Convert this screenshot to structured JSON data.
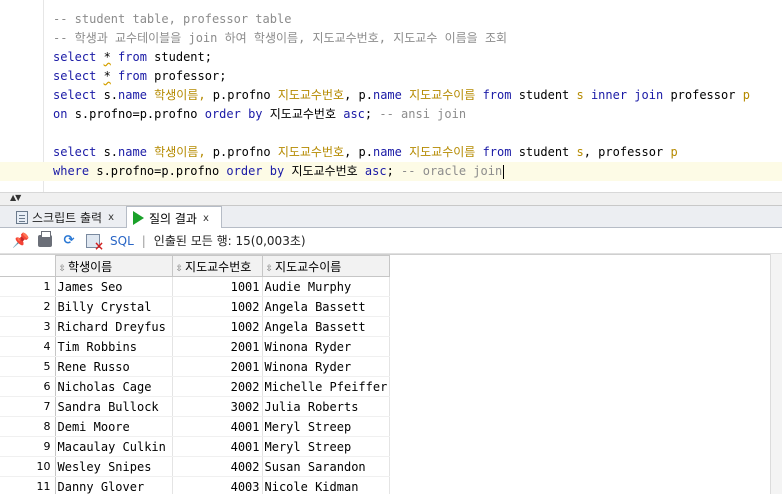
{
  "editor": {
    "lines": [
      [
        {
          "t": "-- student table, professor table",
          "c": "cm"
        }
      ],
      [
        {
          "t": "-- 학생과 교수테이블을 join 하여 학생이름, 지도교수번호, 지도교수 이름을 조회",
          "c": "cm"
        }
      ],
      [
        {
          "t": "select ",
          "c": "kw"
        },
        {
          "t": "*",
          "c": "star"
        },
        {
          "t": " from ",
          "c": "kw"
        },
        {
          "t": "student;",
          "c": "pl"
        }
      ],
      [
        {
          "t": "select ",
          "c": "kw"
        },
        {
          "t": "*",
          "c": "star"
        },
        {
          "t": " from ",
          "c": "kw"
        },
        {
          "t": "professor;",
          "c": "pl"
        }
      ],
      [
        {
          "t": "select ",
          "c": "kw"
        },
        {
          "t": "s.",
          "c": "pl"
        },
        {
          "t": "name",
          "c": "id"
        },
        {
          "t": " 학생이름, ",
          "c": "al"
        },
        {
          "t": "p.profno ",
          "c": "pl"
        },
        {
          "t": "지도교수번호",
          "c": "al"
        },
        {
          "t": ", p.",
          "c": "pl"
        },
        {
          "t": "name",
          "c": "id"
        },
        {
          "t": " 지도교수이름 ",
          "c": "al"
        },
        {
          "t": "from ",
          "c": "kw"
        },
        {
          "t": "student ",
          "c": "pl"
        },
        {
          "t": "s ",
          "c": "al"
        },
        {
          "t": "inner join ",
          "c": "kw"
        },
        {
          "t": "professor ",
          "c": "pl"
        },
        {
          "t": "p",
          "c": "al"
        }
      ],
      [
        {
          "t": "on ",
          "c": "kw"
        },
        {
          "t": "s.profno=p.profno ",
          "c": "pl"
        },
        {
          "t": "order by ",
          "c": "kw"
        },
        {
          "t": "지도교수번호 ",
          "c": "pl"
        },
        {
          "t": "asc",
          "c": "kw"
        },
        {
          "t": "; ",
          "c": "pl"
        },
        {
          "t": "-- ansi join",
          "c": "cm"
        }
      ],
      [],
      [
        {
          "t": "select ",
          "c": "kw"
        },
        {
          "t": "s.",
          "c": "pl"
        },
        {
          "t": "name",
          "c": "id"
        },
        {
          "t": " 학생이름, ",
          "c": "al"
        },
        {
          "t": "p.profno ",
          "c": "pl"
        },
        {
          "t": "지도교수번호",
          "c": "al"
        },
        {
          "t": ", p.",
          "c": "pl"
        },
        {
          "t": "name",
          "c": "id"
        },
        {
          "t": " 지도교수이름 ",
          "c": "al"
        },
        {
          "t": "from ",
          "c": "kw"
        },
        {
          "t": "student ",
          "c": "pl"
        },
        {
          "t": "s",
          "c": "al"
        },
        {
          "t": ", professor ",
          "c": "pl"
        },
        {
          "t": "p",
          "c": "al"
        }
      ],
      [
        {
          "t": "where ",
          "c": "kw"
        },
        {
          "t": "s.profno=p.profno ",
          "c": "pl"
        },
        {
          "t": "order by ",
          "c": "kw"
        },
        {
          "t": "지도교수번호 ",
          "c": "pl"
        },
        {
          "t": "asc",
          "c": "kw"
        },
        {
          "t": "; ",
          "c": "pl"
        },
        {
          "t": "-- oracle join",
          "c": "cm"
        }
      ]
    ],
    "current_line": 8
  },
  "tabs": {
    "script_output": "스크립트 출력",
    "query_result": "질의 결과",
    "close_glyph": "x"
  },
  "toolbar": {
    "sql_label": "SQL",
    "separator": "|",
    "status": "인출된 모든 행: 15(0,003초)"
  },
  "grid": {
    "columns": [
      "학생이름",
      "지도교수번호",
      "지도교수이름"
    ],
    "rows": [
      [
        "1",
        "James Seo",
        "1001",
        "Audie Murphy"
      ],
      [
        "2",
        "Billy Crystal",
        "1002",
        "Angela Bassett"
      ],
      [
        "3",
        "Richard Dreyfus",
        "1002",
        "Angela Bassett"
      ],
      [
        "4",
        "Tim Robbins",
        "2001",
        "Winona Ryder"
      ],
      [
        "5",
        "Rene Russo",
        "2001",
        "Winona Ryder"
      ],
      [
        "6",
        "Nicholas Cage",
        "2002",
        "Michelle Pfeiffer"
      ],
      [
        "7",
        "Sandra Bullock",
        "3002",
        "Julia Roberts"
      ],
      [
        "8",
        "Demi Moore",
        "4001",
        "Meryl Streep"
      ],
      [
        "9",
        "Macaulay Culkin",
        "4001",
        "Meryl Streep"
      ],
      [
        "10",
        "Wesley Snipes",
        "4002",
        "Susan Sarandon"
      ],
      [
        "11",
        "Danny Glover",
        "4003",
        "Nicole Kidman"
      ]
    ]
  },
  "icons": {
    "pin": "pin-icon",
    "print": "print-icon",
    "refresh": "refresh-icon",
    "export": "export-icon",
    "sort": "sort-icon"
  }
}
